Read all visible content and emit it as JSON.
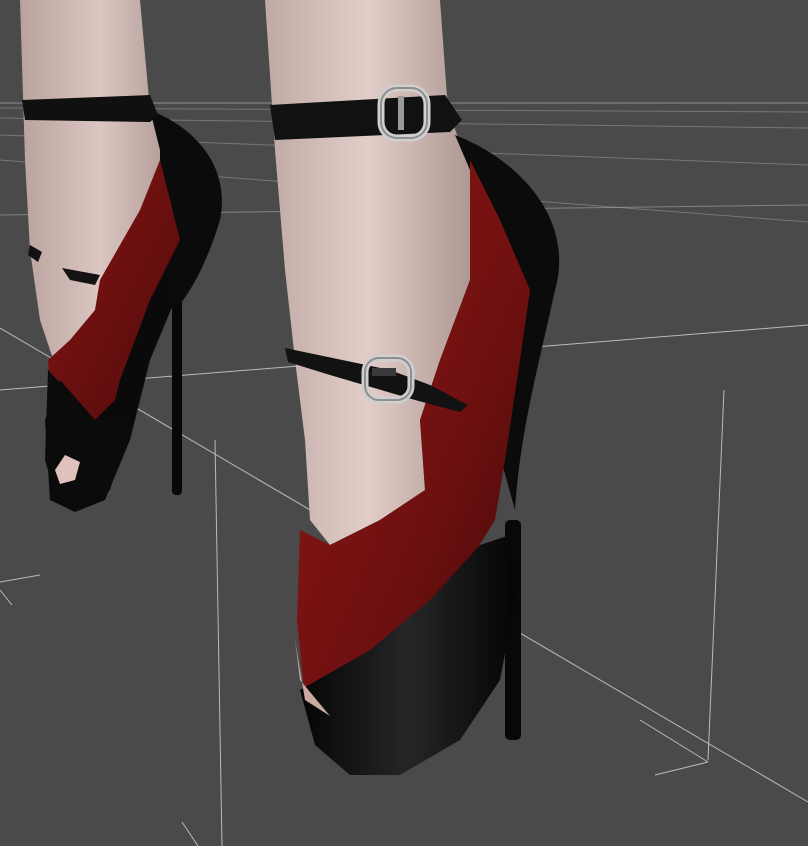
{
  "viewport": {
    "background_color": "#4a4a4a",
    "grid_color": "#ffffff"
  },
  "model": {
    "skin_color": "#cdb7b2",
    "leather_red": "#7a1212",
    "leather_black": "#0d0d0d",
    "buckle_color": "#c8c8c8"
  }
}
